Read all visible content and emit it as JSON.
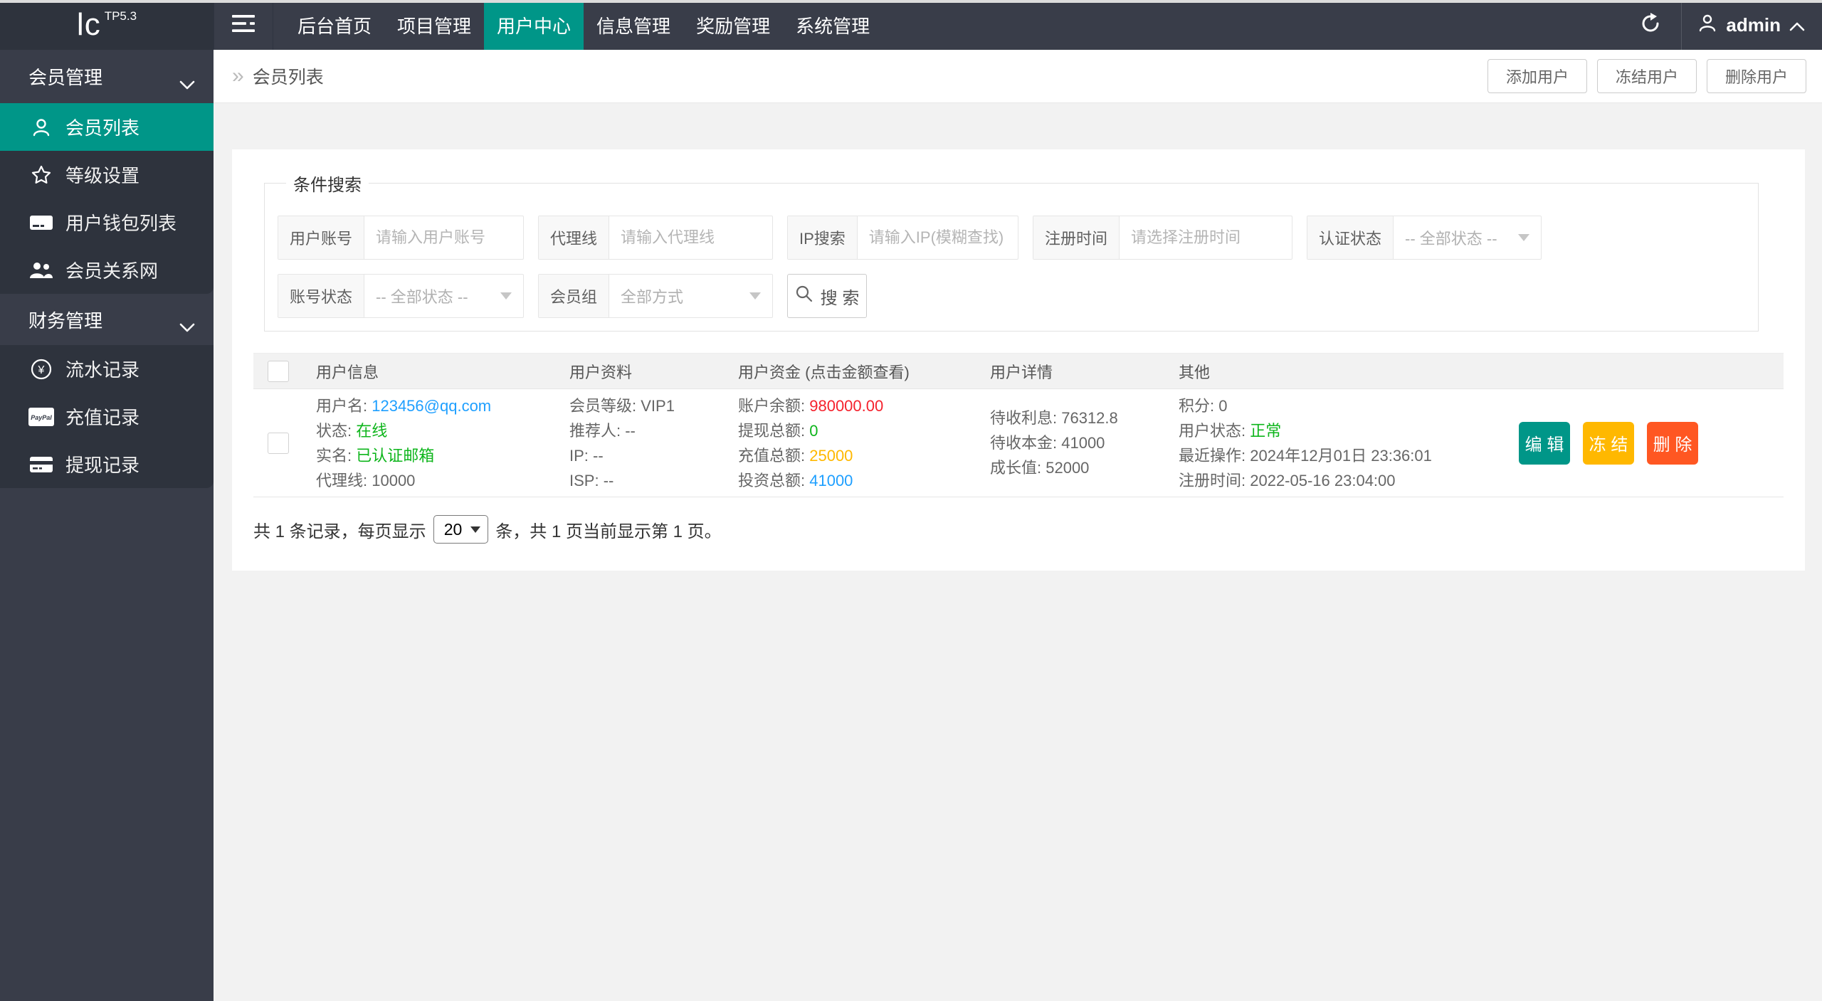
{
  "colors": {
    "accent_teal": "#009688",
    "topbar_bg": "#393D49",
    "dark_panel": "#2E333D",
    "link_blue": "#1E9FFF",
    "ok_green": "#0DB51B",
    "alert_red": "#F5222D",
    "warn_orange": "#FFB800",
    "danger_orange": "#FF5722",
    "page_bg": "#f2f2f2"
  },
  "topbar": {
    "logo": "lc",
    "logo_sup": "TP5.3",
    "nav": [
      "后台首页",
      "项目管理",
      "用户中心",
      "信息管理",
      "奖励管理",
      "系统管理"
    ],
    "username": "admin"
  },
  "sidebar": {
    "group1": {
      "title": "会员管理",
      "items": [
        "会员列表",
        "等级设置",
        "用户钱包列表",
        "会员关系网"
      ]
    },
    "group2": {
      "title": "财务管理",
      "items": [
        "流水记录",
        "充值记录",
        "提现记录"
      ]
    },
    "yen_glyph": "¥",
    "paypal_text": "PayPal"
  },
  "breadcrumb": {
    "arrow": "»",
    "title": "会员列表"
  },
  "page_actions": {
    "add": "添加用户",
    "freeze": "冻结用户",
    "delete": "删除用户"
  },
  "filter": {
    "legend": "条件搜索",
    "account": {
      "label": "用户账号",
      "placeholder": "请输入用户账号"
    },
    "agent": {
      "label": "代理线",
      "placeholder": "请输入代理线"
    },
    "ip": {
      "label": "IP搜索",
      "placeholder": "请输入IP(模糊查找)"
    },
    "regtime": {
      "label": "注册时间",
      "placeholder": "请选择注册时间"
    },
    "auth_status": {
      "label": "认证状态",
      "value": "-- 全部状态 --"
    },
    "account_status": {
      "label": "账号状态",
      "value": "-- 全部状态 --"
    },
    "member_group": {
      "label": "会员组",
      "value": "全部方式"
    },
    "search_label": "搜 索"
  },
  "table": {
    "headers": {
      "user_info": "用户信息",
      "user_profile": "用户资料",
      "user_funds": "用户资金 (点击金额查看)",
      "user_detail": "用户详情",
      "other": "其他"
    },
    "row": {
      "username_label": "用户名: ",
      "username": "123456@qq.com",
      "status_label": "状态: ",
      "status": "在线",
      "realname_label": "实名: ",
      "realname": "已认证邮箱",
      "agent_label": "代理线: ",
      "agent": "10000",
      "level_label": "会员等级: ",
      "level": "VIP1",
      "referrer_label": "推荐人: ",
      "referrer": "--",
      "ip_label": "IP: ",
      "ip": "--",
      "isp_label": "ISP: ",
      "isp": "--",
      "balance_label": "账户余额: ",
      "balance": "980000.00",
      "withdraw_label": "提现总额: ",
      "withdraw": "0",
      "recharge_label": "充值总额: ",
      "recharge": "25000",
      "invest_label": "投资总额: ",
      "invest": "41000",
      "interest_label": "待收利息: ",
      "interest": "76312.8",
      "principal_label": "待收本金: ",
      "principal": "41000",
      "growth_label": "成长值: ",
      "growth": "52000",
      "points_label": "积分: ",
      "points": "0",
      "user_status_label": "用户状态: ",
      "user_status": "正常",
      "last_op_label": "最近操作: ",
      "last_op": "2024年12月01日 23:36:01",
      "reg_time_label": "注册时间: ",
      "reg_time": "2022-05-16 23:04:00",
      "actions": {
        "edit": "编 辑",
        "freeze": "冻 结",
        "delete": "删 除"
      }
    }
  },
  "pagination": {
    "prefix": "共 1 条记录，每页显示",
    "page_size": "20",
    "suffix": "条，共 1 页当前显示第 1 页。"
  }
}
